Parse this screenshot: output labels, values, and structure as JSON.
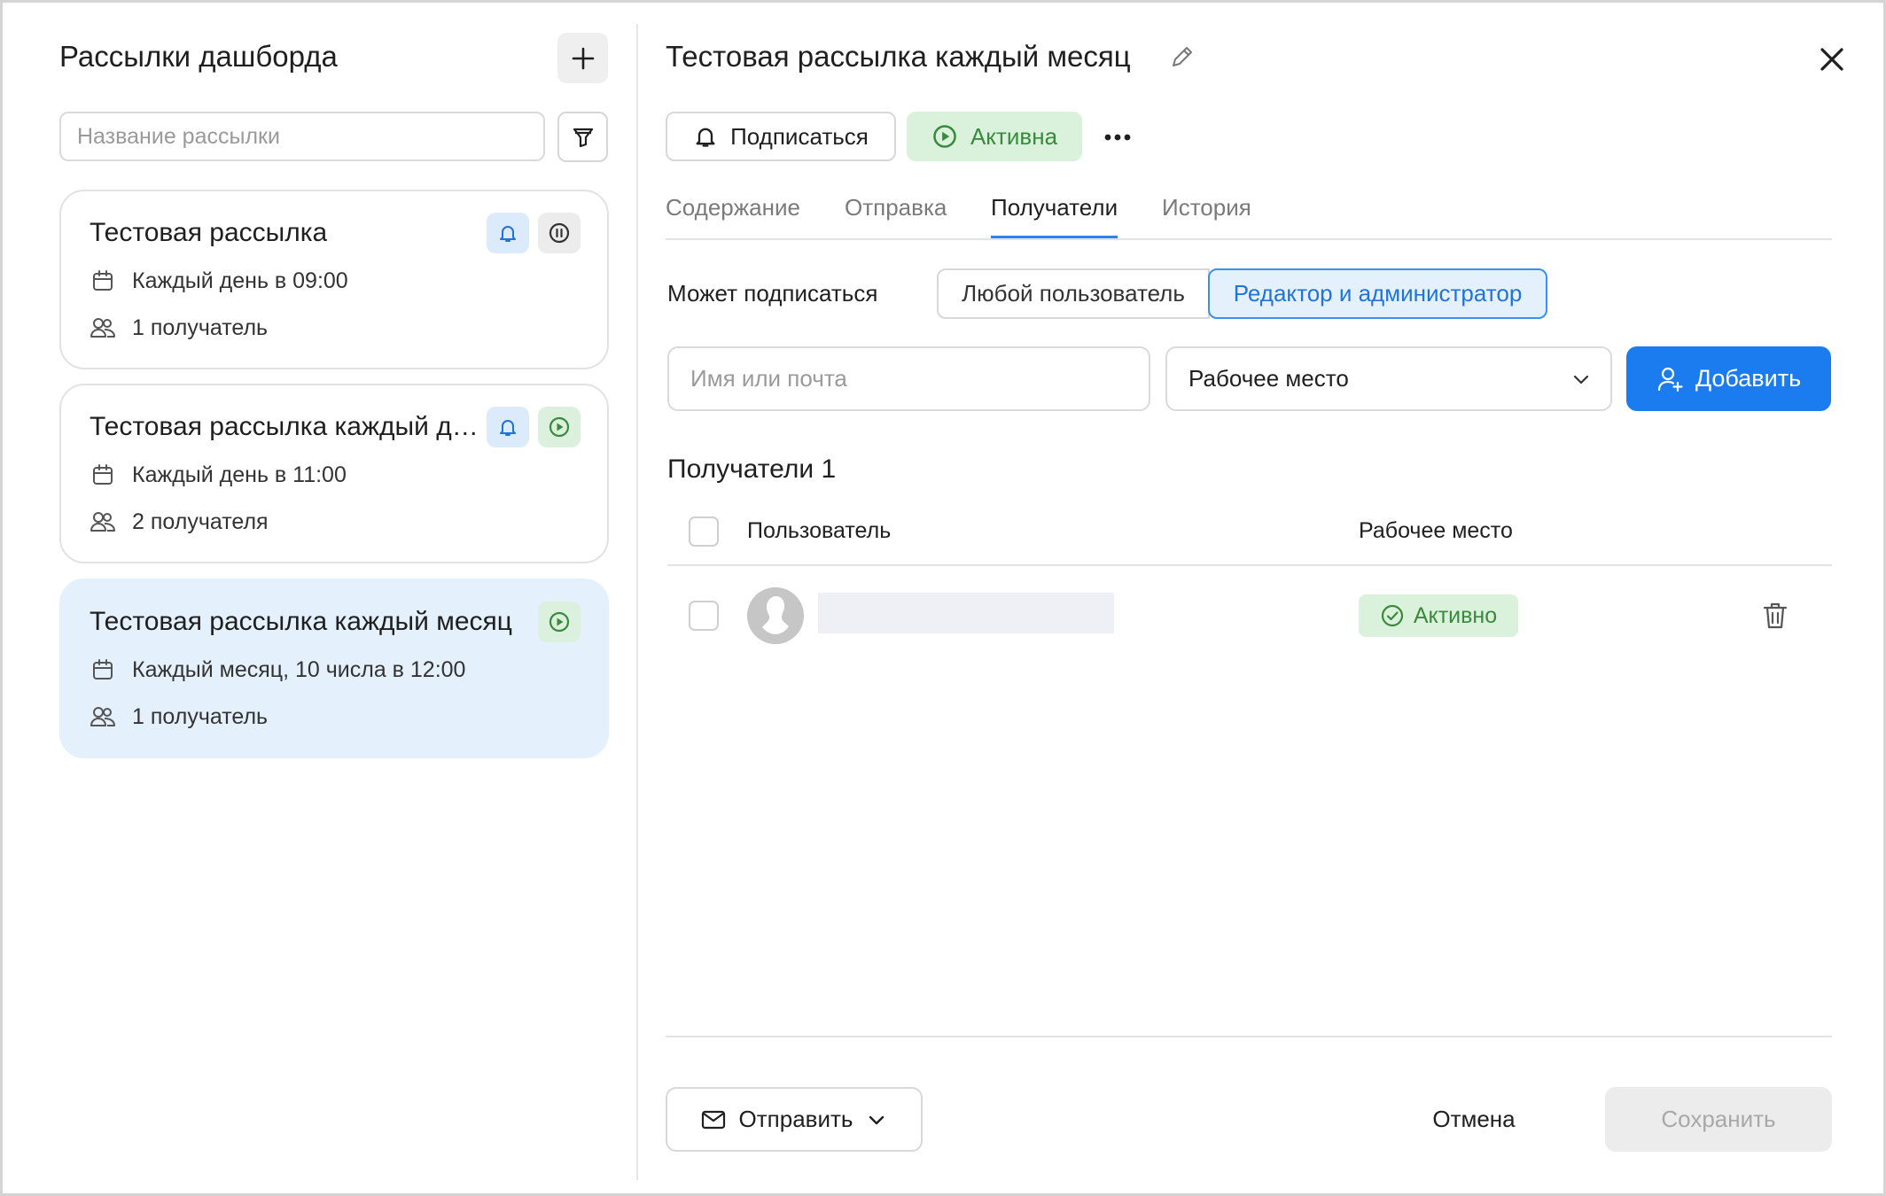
{
  "sidebar": {
    "title": "Рассылки дашборда",
    "search_placeholder": "Название рассылки",
    "items": [
      {
        "title": "Тестовая рассылка",
        "schedule": "Каждый день в 09:00",
        "recipients": "1 получатель"
      },
      {
        "title": "Тестовая рассылка каждый день",
        "schedule": "Каждый день в 11:00",
        "recipients": "2 получателя"
      },
      {
        "title": "Тестовая рассылка каждый месяц",
        "schedule": "Каждый месяц, 10 числа в 12:00",
        "recipients": "1 получатель"
      }
    ]
  },
  "detail": {
    "title": "Тестовая рассылка каждый месяц",
    "subscribe_label": "Подписаться",
    "status_label": "Активна",
    "tabs": [
      "Содержание",
      "Отправка",
      "Получатели",
      "История"
    ],
    "active_tab": "Получатели",
    "can_subscribe_label": "Может подписаться",
    "segment": {
      "any": "Любой пользователь",
      "editor": "Редактор и администратор",
      "selected": "editor"
    },
    "name_placeholder": "Имя или почта",
    "workspace_select": "Рабочее место",
    "add_label": "Добавить",
    "recipients_title": "Получатели 1",
    "table": {
      "col_user": "Пользователь",
      "col_workspace": "Рабочее место",
      "rows": [
        {
          "status": "Активно"
        }
      ]
    },
    "footer": {
      "send_label": "Отправить",
      "cancel_label": "Отмена",
      "save_label": "Сохранить"
    }
  },
  "colors": {
    "accent": "#1b7cf0",
    "active_green": "#3a8a3e",
    "selected_bg": "#e4f1fc"
  }
}
